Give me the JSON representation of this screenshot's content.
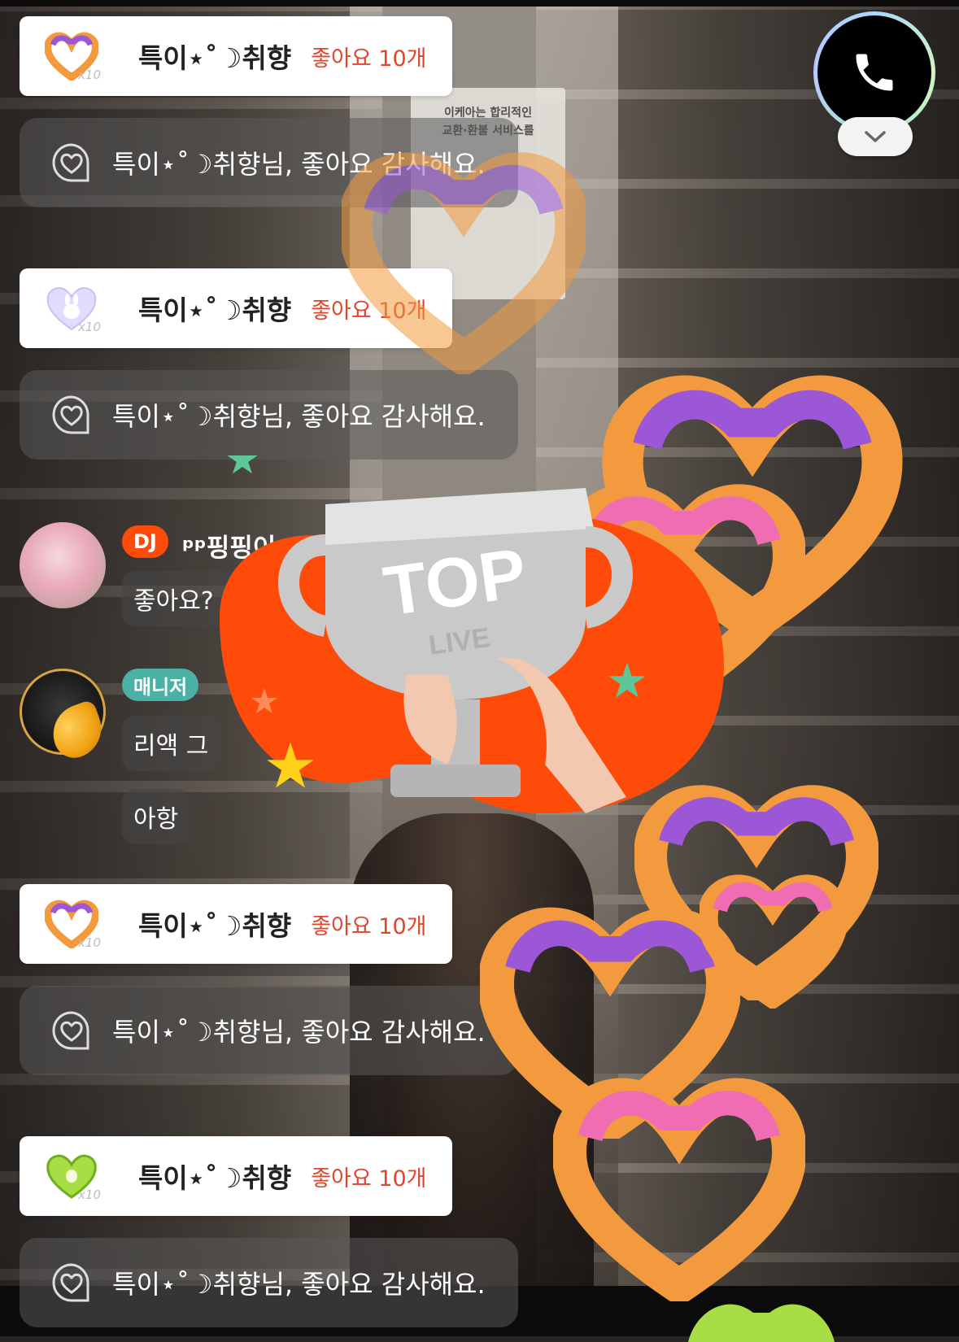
{
  "like_cards": [
    {
      "nick": "특이⋆˚☽취향",
      "count": "좋아요 10개",
      "multiplier": "x10",
      "gift": "churro-heart"
    },
    {
      "nick": "특이⋆˚☽취향",
      "count": "좋아요 10개",
      "multiplier": "x10",
      "gift": "bunny-heart"
    },
    {
      "nick": "특이⋆˚☽취향",
      "count": "좋아요 10개",
      "multiplier": "x10",
      "gift": "churro-heart"
    },
    {
      "nick": "특이⋆˚☽취향",
      "count": "좋아요 10개",
      "multiplier": "x10",
      "gift": "kiwi-heart"
    }
  ],
  "thanks_messages": [
    "특이⋆˚☽취향님, 좋아요 감사해요.",
    "특이⋆˚☽취향님, 좋아요 감사해요.",
    "특이⋆˚☽취향님, 좋아요 감사해요.",
    "특이⋆˚☽취향님, 좋아요 감사해요."
  ],
  "chat": {
    "dj": {
      "badge": "DJ",
      "name": "ᵖᵖ핑핑이",
      "message": "좋아요? 사랑해"
    },
    "manager": {
      "badge": "매니저",
      "name": "",
      "messages": [
        "리액 그",
        "아항"
      ]
    }
  },
  "overlay": {
    "trophy_text": "TOP",
    "trophy_subtext": "LIVE"
  },
  "background_sign": [
    "이케아는 합리적인",
    "교환·환불 서비스를"
  ],
  "colors": {
    "accent": "#ff4b0a",
    "manager_badge": "#4bb1a6",
    "like_count": "#e0452d"
  },
  "icons": {
    "call": "phone-icon",
    "collapse": "chevron-down-icon",
    "like": "heart-chat-icon"
  }
}
